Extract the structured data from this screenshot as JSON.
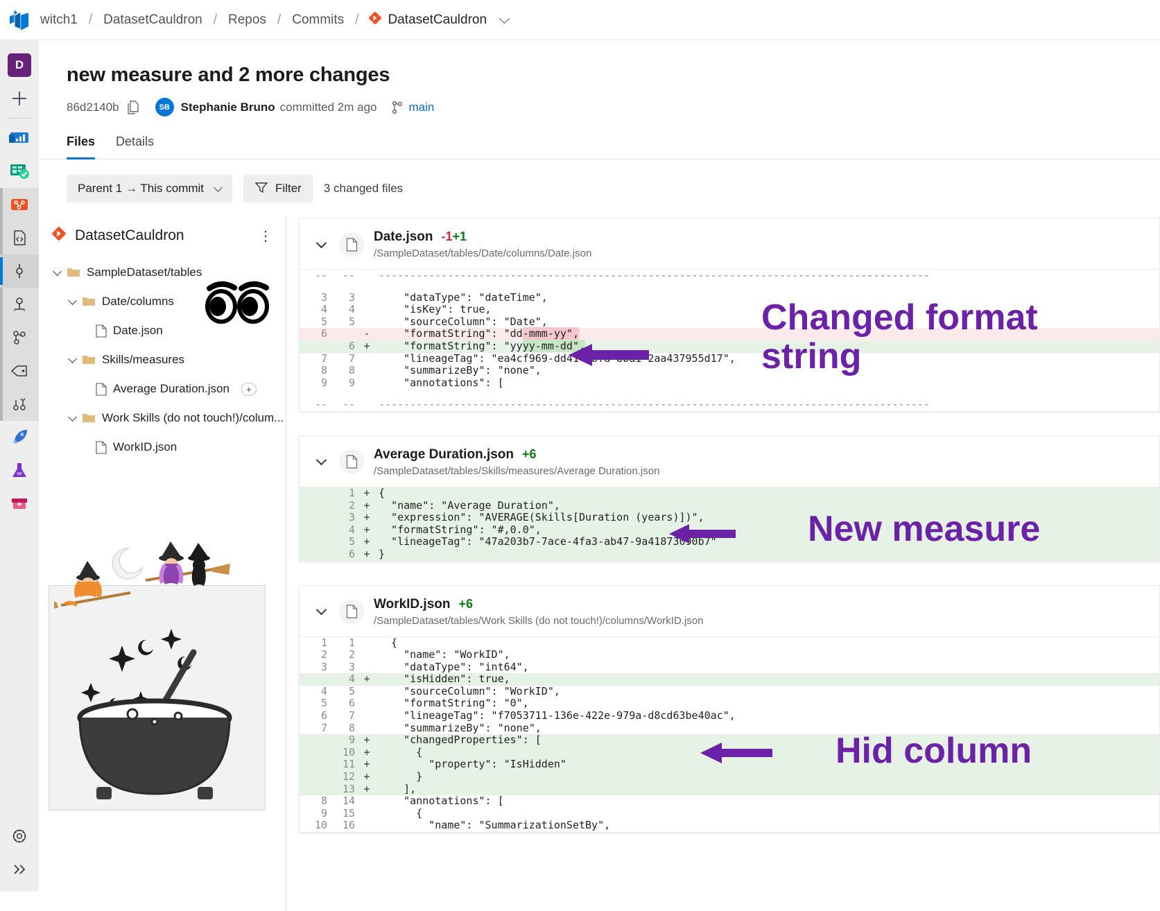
{
  "breadcrumb": {
    "items": [
      {
        "label": "witch1",
        "icon": "none"
      },
      {
        "label": "DatasetCauldron",
        "icon": "none"
      },
      {
        "label": "Repos",
        "icon": "none"
      },
      {
        "label": "Commits",
        "icon": "none"
      }
    ],
    "separator": "/",
    "repo_selector": "DatasetCauldron"
  },
  "rail": {
    "org_initial": "D",
    "items": [
      {
        "name": "new-item",
        "icon": "plus-icon"
      },
      {
        "name": "overview",
        "icon": "overview-icon"
      },
      {
        "name": "boards",
        "icon": "boards-icon"
      },
      {
        "name": "repos",
        "icon": "repos-icon"
      },
      {
        "name": "files",
        "icon": "code-file-icon"
      },
      {
        "name": "commits",
        "icon": "commits-icon"
      },
      {
        "name": "pushes",
        "icon": "pushes-icon"
      },
      {
        "name": "branches",
        "icon": "branches-icon"
      },
      {
        "name": "tags",
        "icon": "tag-icon"
      },
      {
        "name": "pull-requests",
        "icon": "pull-request-icon"
      },
      {
        "name": "pipelines",
        "icon": "rocket-icon"
      },
      {
        "name": "test-plans",
        "icon": "flask-icon"
      },
      {
        "name": "artifacts",
        "icon": "artifacts-icon"
      }
    ],
    "settings_icon": "gear-icon",
    "expand_icon": "double-chevron-right-icon"
  },
  "commit": {
    "title": "new measure and 2 more changes",
    "hash": "86d2140b",
    "copy_icon": "copy-icon",
    "author_initials": "SB",
    "author": "Stephanie Bruno",
    "committed_text": "committed 2m ago",
    "branch_icon": "branch-icon",
    "branch": "main"
  },
  "tabs": [
    {
      "label": "Files",
      "selected": true
    },
    {
      "label": "Details",
      "selected": false
    }
  ],
  "toolbar": {
    "compare_label": "Parent 1 → This commit",
    "filter_label": "Filter",
    "filter_icon": "filter-icon",
    "changed_files": "3 changed files"
  },
  "tree": {
    "repo_name": "DatasetCauldron",
    "repo_icon": "repo-diamond-icon",
    "kebab_icon": "more-actions-icon",
    "nodes": [
      {
        "label": "SampleDataset/tables",
        "type": "folder",
        "depth": 0,
        "expanded": true,
        "badge": ""
      },
      {
        "label": "Date/columns",
        "type": "folder",
        "depth": 1,
        "expanded": true,
        "badge": ""
      },
      {
        "label": "Date.json",
        "type": "file",
        "depth": 2,
        "expanded": false,
        "badge": ""
      },
      {
        "label": "Skills/measures",
        "type": "folder",
        "depth": 1,
        "expanded": true,
        "badge": ""
      },
      {
        "label": "Average Duration.json",
        "type": "file",
        "depth": 2,
        "expanded": false,
        "badge": "+"
      },
      {
        "label": "Work Skills (do not touch!)/colum...",
        "type": "folder",
        "depth": 1,
        "expanded": true,
        "badge": ""
      },
      {
        "label": "WorkID.json",
        "type": "file",
        "depth": 2,
        "expanded": false,
        "badge": ""
      }
    ],
    "decoration_eyes": "eyes-emoji",
    "decoration_art": "cauldron-illustration"
  },
  "diffs": [
    {
      "file_name": "Date.json",
      "removed": "-1",
      "added": "+1",
      "path": "/SampleDataset/tables/Date/columns/Date.json",
      "lines": [
        {
          "old": "--",
          "new": "--",
          "sign": "",
          "code": "----------------------------------------------------------------------------------------",
          "kind": "ctx-dots"
        },
        {
          "old": "",
          "new": "",
          "sign": "",
          "code": "",
          "kind": "pad"
        },
        {
          "old": "3",
          "new": "3",
          "sign": "",
          "code": "    \"dataType\": \"dateTime\",",
          "kind": "ctx"
        },
        {
          "old": "4",
          "new": "4",
          "sign": "",
          "code": "    \"isKey\": true,",
          "kind": "ctx"
        },
        {
          "old": "5",
          "new": "5",
          "sign": "",
          "code": "    \"sourceColumn\": \"Date\",",
          "kind": "ctx"
        },
        {
          "old": "6",
          "new": "",
          "sign": "-",
          "code": "    \"formatString\": \"dd-mmm-yy\",",
          "kind": "del",
          "hl_from": 23,
          "hl_to": 32
        },
        {
          "old": "",
          "new": "6",
          "sign": "+",
          "code": "    \"formatString\": \"yyyy-mm-dd\",",
          "kind": "add",
          "hl_from": 23,
          "hl_to": 33
        },
        {
          "old": "7",
          "new": "7",
          "sign": "",
          "code": "    \"lineageTag\": \"ea4cf969-dd41-4bfa-8ba1-2aa437955d17\",",
          "kind": "ctx"
        },
        {
          "old": "8",
          "new": "8",
          "sign": "",
          "code": "    \"summarizeBy\": \"none\",",
          "kind": "ctx"
        },
        {
          "old": "9",
          "new": "9",
          "sign": "",
          "code": "    \"annotations\": [",
          "kind": "ctx"
        },
        {
          "old": "",
          "new": "",
          "sign": "",
          "code": "",
          "kind": "pad"
        },
        {
          "old": "--",
          "new": "--",
          "sign": "",
          "code": "----------------------------------------------------------------------------------------",
          "kind": "ctx-dots"
        }
      ]
    },
    {
      "file_name": "Average Duration.json",
      "removed": "",
      "added": "+6",
      "path": "/SampleDataset/tables/Skills/measures/Average Duration.json",
      "lines": [
        {
          "old": "",
          "new": "1",
          "sign": "+",
          "code": "{",
          "kind": "add"
        },
        {
          "old": "",
          "new": "2",
          "sign": "+",
          "code": "  \"name\": \"Average Duration\",",
          "kind": "add"
        },
        {
          "old": "",
          "new": "3",
          "sign": "+",
          "code": "  \"expression\": \"AVERAGE(Skills[Duration (years)])\",",
          "kind": "add"
        },
        {
          "old": "",
          "new": "4",
          "sign": "+",
          "code": "  \"formatString\": \"#,0.0\",",
          "kind": "add"
        },
        {
          "old": "",
          "new": "5",
          "sign": "+",
          "code": "  \"lineageTag\": \"47a203b7-7ace-4fa3-ab47-9a41873090b7\"",
          "kind": "add"
        },
        {
          "old": "",
          "new": "6",
          "sign": "+",
          "code": "}",
          "kind": "add"
        }
      ]
    },
    {
      "file_name": "WorkID.json",
      "removed": "",
      "added": "+6",
      "path": "/SampleDataset/tables/Work Skills (do not touch!)/columns/WorkID.json",
      "lines": [
        {
          "old": "1",
          "new": "1",
          "sign": "",
          "code": "  {",
          "kind": "ctx"
        },
        {
          "old": "2",
          "new": "2",
          "sign": "",
          "code": "    \"name\": \"WorkID\",",
          "kind": "ctx"
        },
        {
          "old": "3",
          "new": "3",
          "sign": "",
          "code": "    \"dataType\": \"int64\",",
          "kind": "ctx"
        },
        {
          "old": "",
          "new": "4",
          "sign": "+",
          "code": "    \"isHidden\": true,",
          "kind": "add"
        },
        {
          "old": "4",
          "new": "5",
          "sign": "",
          "code": "    \"sourceColumn\": \"WorkID\",",
          "kind": "ctx"
        },
        {
          "old": "5",
          "new": "6",
          "sign": "",
          "code": "    \"formatString\": \"0\",",
          "kind": "ctx"
        },
        {
          "old": "6",
          "new": "7",
          "sign": "",
          "code": "    \"lineageTag\": \"f7053711-136e-422e-979a-d8cd63be40ac\",",
          "kind": "ctx"
        },
        {
          "old": "7",
          "new": "8",
          "sign": "",
          "code": "    \"summarizeBy\": \"none\",",
          "kind": "ctx"
        },
        {
          "old": "",
          "new": "9",
          "sign": "+",
          "code": "    \"changedProperties\": [",
          "kind": "add"
        },
        {
          "old": "",
          "new": "10",
          "sign": "+",
          "code": "      {",
          "kind": "add"
        },
        {
          "old": "",
          "new": "11",
          "sign": "+",
          "code": "        \"property\": \"IsHidden\"",
          "kind": "add"
        },
        {
          "old": "",
          "new": "12",
          "sign": "+",
          "code": "      }",
          "kind": "add"
        },
        {
          "old": "",
          "new": "13",
          "sign": "+",
          "code": "    ],",
          "kind": "add"
        },
        {
          "old": "8",
          "new": "14",
          "sign": "",
          "code": "    \"annotations\": [",
          "kind": "ctx"
        },
        {
          "old": "9",
          "new": "15",
          "sign": "",
          "code": "      {",
          "kind": "ctx"
        },
        {
          "old": "10",
          "new": "16",
          "sign": "",
          "code": "        \"name\": \"SummarizationSetBy\",",
          "kind": "ctx"
        }
      ]
    }
  ],
  "annotations": [
    {
      "text": "Changed format string",
      "name": "annotation-changed-format-string"
    },
    {
      "text": "New measure",
      "name": "annotation-new-measure"
    },
    {
      "text": "Hid column",
      "name": "annotation-hid-column"
    }
  ],
  "colors": {
    "accent": "#0078d4",
    "added": "#107c10",
    "removed": "#cc2936",
    "annotation_purple": "#6c22a6",
    "add_row_bg": "#e7f2e7",
    "del_row_bg": "#fbe9ec"
  }
}
